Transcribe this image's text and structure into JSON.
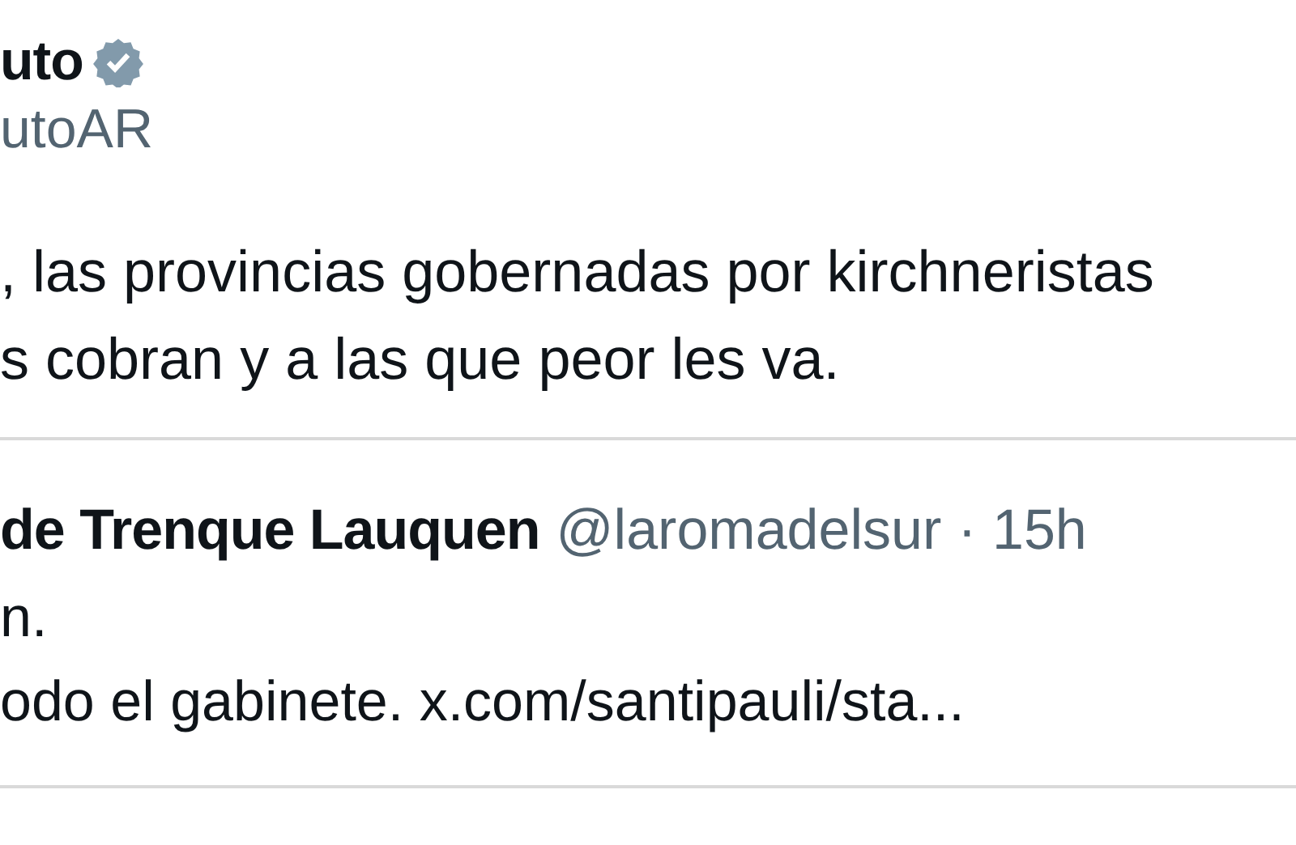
{
  "author": {
    "name": "uto",
    "verified": true,
    "handle": "utoAR"
  },
  "text_lines": [
    ", las provincias gobernadas por kirchneristas",
    "s cobran y a las que peor les va."
  ],
  "quoted": {
    "name": "de Trenque Lauquen",
    "handle": "@laromadelsur",
    "time": "· 15h",
    "text_lines": [
      "n.",
      "odo el gabinete. x.com/santipauli/sta..."
    ]
  }
}
